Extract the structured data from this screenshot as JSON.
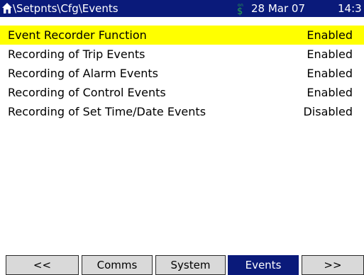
{
  "header": {
    "path": "\\Setpnts\\Cfg\\Events",
    "date": "28 Mar 07",
    "time": "14:3",
    "icons": {
      "home": "home-icon",
      "status": "status-icon"
    },
    "colors": {
      "background": "#0a1a7a",
      "text": "#ffffff",
      "status_icon": "#2aa84a"
    }
  },
  "events": {
    "items": [
      {
        "label": "Event Recorder Function",
        "value": "Enabled"
      },
      {
        "label": "Recording of Trip Events",
        "value": "Enabled"
      },
      {
        "label": "Recording of Alarm Events",
        "value": "Enabled"
      },
      {
        "label": "Recording of Control Events",
        "value": "Enabled"
      },
      {
        "label": "Recording of Set Time/Date Events",
        "value": "Disabled"
      }
    ],
    "selected_color": "#ffff00"
  },
  "tabs": [
    {
      "label": "<<"
    },
    {
      "label": "Comms"
    },
    {
      "label": "System"
    },
    {
      "label": "Events",
      "active": true
    },
    {
      "label": ">>"
    }
  ],
  "tab_colors": {
    "inactive": "#d9d9d9",
    "active": "#0a1a7a"
  }
}
